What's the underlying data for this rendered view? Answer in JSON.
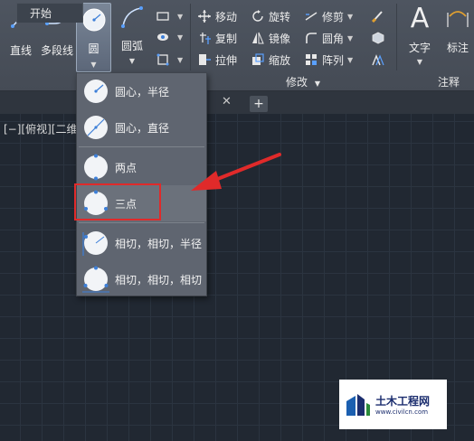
{
  "ribbon": {
    "draw": {
      "line_label": "直线",
      "polyline_label": "多段线",
      "circle_label": "圆",
      "arc_label": "圆弧"
    },
    "modify": {
      "move_label": "移动",
      "rotate_label": "旋转",
      "trim_label": "修剪",
      "copy_label": "复制",
      "mirror_label": "镜像",
      "fillet_label": "圆角",
      "stretch_label": "拉伸",
      "scale_label": "缩放",
      "array_label": "阵列",
      "panel_title": "修改"
    },
    "annotation": {
      "text_label": "文字",
      "dimension_label": "标注",
      "panel_title": "注释"
    }
  },
  "tabs": {
    "start_label": "开始",
    "close_symbol": "✕",
    "add_symbol": "+"
  },
  "viewport": {
    "label": "[−][俯视][二维线"
  },
  "circle_menu": {
    "items": [
      {
        "label": "圆心，半径"
      },
      {
        "label": "圆心，直径"
      },
      {
        "label": "两点"
      },
      {
        "label": "三点"
      },
      {
        "label": "相切，相切，半径"
      },
      {
        "label": "相切，相切，相切"
      }
    ]
  },
  "watermark": {
    "title": "土木工程网",
    "url": "www.civilcn.com"
  },
  "colors": {
    "highlight": "#e02a2a",
    "canvas": "#212832",
    "ribbon": "#4b525c"
  }
}
